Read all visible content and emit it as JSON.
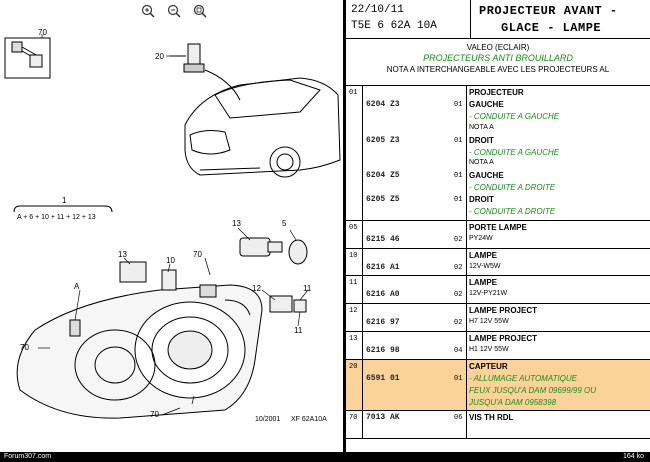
{
  "toolbar": {
    "zoom_in": "zoom-in-icon",
    "zoom_out": "zoom-out-icon",
    "zoom_fit": "zoom-fit-icon"
  },
  "diagram": {
    "callouts": [
      "70",
      "20",
      "1",
      "A + 6 + 10 + 11 + 12 + 13",
      "5",
      "13",
      "10",
      "70",
      "12",
      "11",
      "A",
      "70",
      "11",
      "70"
    ],
    "stamp": "10/2001",
    "code": "XF 62A10A"
  },
  "header": {
    "date": "22/10/11",
    "ref": "T5E 6 62A 10A",
    "title1": "PROJECTEUR AVANT -",
    "title2": "GLACE - LAMPE"
  },
  "subheader": {
    "line1": "VALEO (ECLAIR)",
    "line2": "PROJECTEURS ANTI BROUILLARD",
    "line3": "NOTA A INTERCHANGEABLE AVEC LES PROJECTEURS AL"
  },
  "groups": [
    {
      "num": "01",
      "refs": [
        "6204 Z3",
        "6205 Z3",
        "6204 Z5",
        "6205 Z5"
      ],
      "qtys": [
        "01",
        "01",
        "01",
        "01"
      ],
      "lines": [
        {
          "t": "PROJECTEUR",
          "c": "b"
        },
        {
          "t": "GAUCHE",
          "c": "b"
        },
        {
          "t": "- CONDUITE A GAUCHE",
          "c": "g"
        },
        {
          "t": "NOTA A",
          "c": "s"
        },
        {
          "t": "DROIT",
          "c": "b"
        },
        {
          "t": "- CONDUITE A GAUCHE",
          "c": "g"
        },
        {
          "t": "NOTA A",
          "c": "s"
        },
        {
          "t": "GAUCHE",
          "c": "b"
        },
        {
          "t": "- CONDUITE A DROITE",
          "c": "g"
        },
        {
          "t": "DROIT",
          "c": "b"
        },
        {
          "t": "- CONDUITE A DROITE",
          "c": "g"
        }
      ]
    },
    {
      "num": "05",
      "refs": [
        "6215 46"
      ],
      "qtys": [
        "02"
      ],
      "lines": [
        {
          "t": "PORTE LAMPE",
          "c": "b"
        },
        {
          "t": "PY24W",
          "c": "s"
        }
      ]
    },
    {
      "num": "10",
      "refs": [
        "6216 A1"
      ],
      "qtys": [
        "02"
      ],
      "lines": [
        {
          "t": "LAMPE",
          "c": "b"
        },
        {
          "t": "12V-W5W",
          "c": "s"
        }
      ]
    },
    {
      "num": "11",
      "refs": [
        "6216 A0"
      ],
      "qtys": [
        "02"
      ],
      "lines": [
        {
          "t": "LAMPE",
          "c": "b"
        },
        {
          "t": "12V-PY21W",
          "c": "s"
        }
      ]
    },
    {
      "num": "12",
      "refs": [
        "6216 97"
      ],
      "qtys": [
        "02"
      ],
      "lines": [
        {
          "t": "LAMPE PROJECT",
          "c": "b"
        },
        {
          "t": "H7 12V 55W",
          "c": "s"
        }
      ]
    },
    {
      "num": "13",
      "refs": [
        "6216 98"
      ],
      "qtys": [
        "04"
      ],
      "lines": [
        {
          "t": "LAMPE PROJECT",
          "c": "b"
        },
        {
          "t": "H1 12V 55W",
          "c": "s"
        }
      ]
    },
    {
      "num": "20",
      "refs": [
        "6591 01"
      ],
      "qtys": [
        "01"
      ],
      "highlight": true,
      "lines": [
        {
          "t": "CAPTEUR",
          "c": "b"
        },
        {
          "t": "- ALLUMAGE AUTOMATIQUE",
          "c": "g"
        },
        {
          "t": "FEUX JUSQU'A DAM 09699/99 OU",
          "c": "g"
        },
        {
          "t": "JUSQU'A DAM 0958398",
          "c": "g"
        }
      ]
    },
    {
      "num": "70",
      "refs": [
        "7013 AK"
      ],
      "qtys": [
        "06"
      ],
      "lines": [
        {
          "t": "VIS TH RDL",
          "c": "b"
        }
      ]
    }
  ],
  "footer": {
    "left": "Forum307.com",
    "right": "164 ko"
  },
  "colors": {
    "highlight": "#fbd29a",
    "green": "#1a8c1a"
  }
}
